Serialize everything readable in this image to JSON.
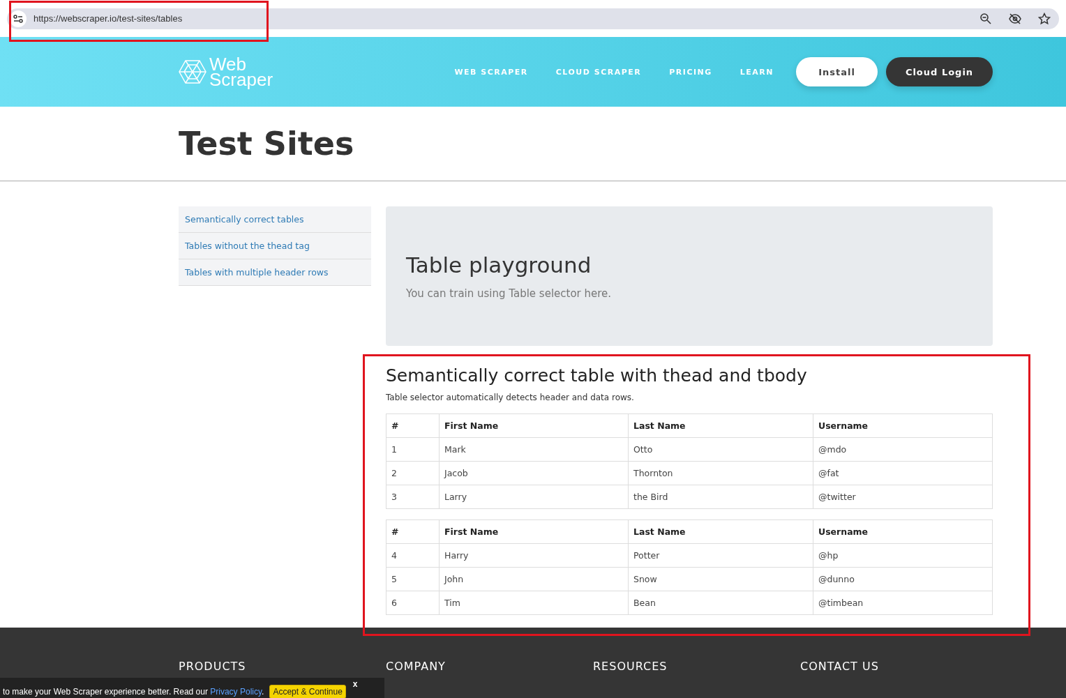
{
  "browser": {
    "url": "https://webscraper.io/test-sites/tables"
  },
  "header": {
    "logo_top": "Web",
    "logo_bottom": "Scraper",
    "nav": [
      "WEB SCRAPER",
      "CLOUD SCRAPER",
      "PRICING",
      "LEARN"
    ],
    "install": "Install",
    "login": "Cloud Login"
  },
  "page_title": "Test Sites",
  "sidebar": {
    "items": [
      {
        "label": "Semantically correct tables"
      },
      {
        "label": "Tables without the thead tag"
      },
      {
        "label": "Tables with multiple header rows"
      }
    ]
  },
  "jumbotron": {
    "title": "Table playground",
    "text": "You can train using Table selector here."
  },
  "section": {
    "title": "Semantically correct table with thead and tbody",
    "subtitle": "Table selector automatically detects header and data rows.",
    "tables": [
      {
        "columns": [
          "#",
          "First Name",
          "Last Name",
          "Username"
        ],
        "rows": [
          [
            "1",
            "Mark",
            "Otto",
            "@mdo"
          ],
          [
            "2",
            "Jacob",
            "Thornton",
            "@fat"
          ],
          [
            "3",
            "Larry",
            "the Bird",
            "@twitter"
          ]
        ]
      },
      {
        "columns": [
          "#",
          "First Name",
          "Last Name",
          "Username"
        ],
        "rows": [
          [
            "4",
            "Harry",
            "Potter",
            "@hp"
          ],
          [
            "5",
            "John",
            "Snow",
            "@dunno"
          ],
          [
            "6",
            "Tim",
            "Bean",
            "@timbean"
          ]
        ]
      }
    ]
  },
  "footer": {
    "headings": [
      "PRODUCTS",
      "COMPANY",
      "RESOURCES",
      "CONTACT US"
    ]
  },
  "cookie_bar": {
    "text": "to make your Web Scraper experience better. Read our",
    "link": "Privacy Policy",
    "after": ".",
    "accept": "Accept & Continue",
    "close": "x"
  }
}
